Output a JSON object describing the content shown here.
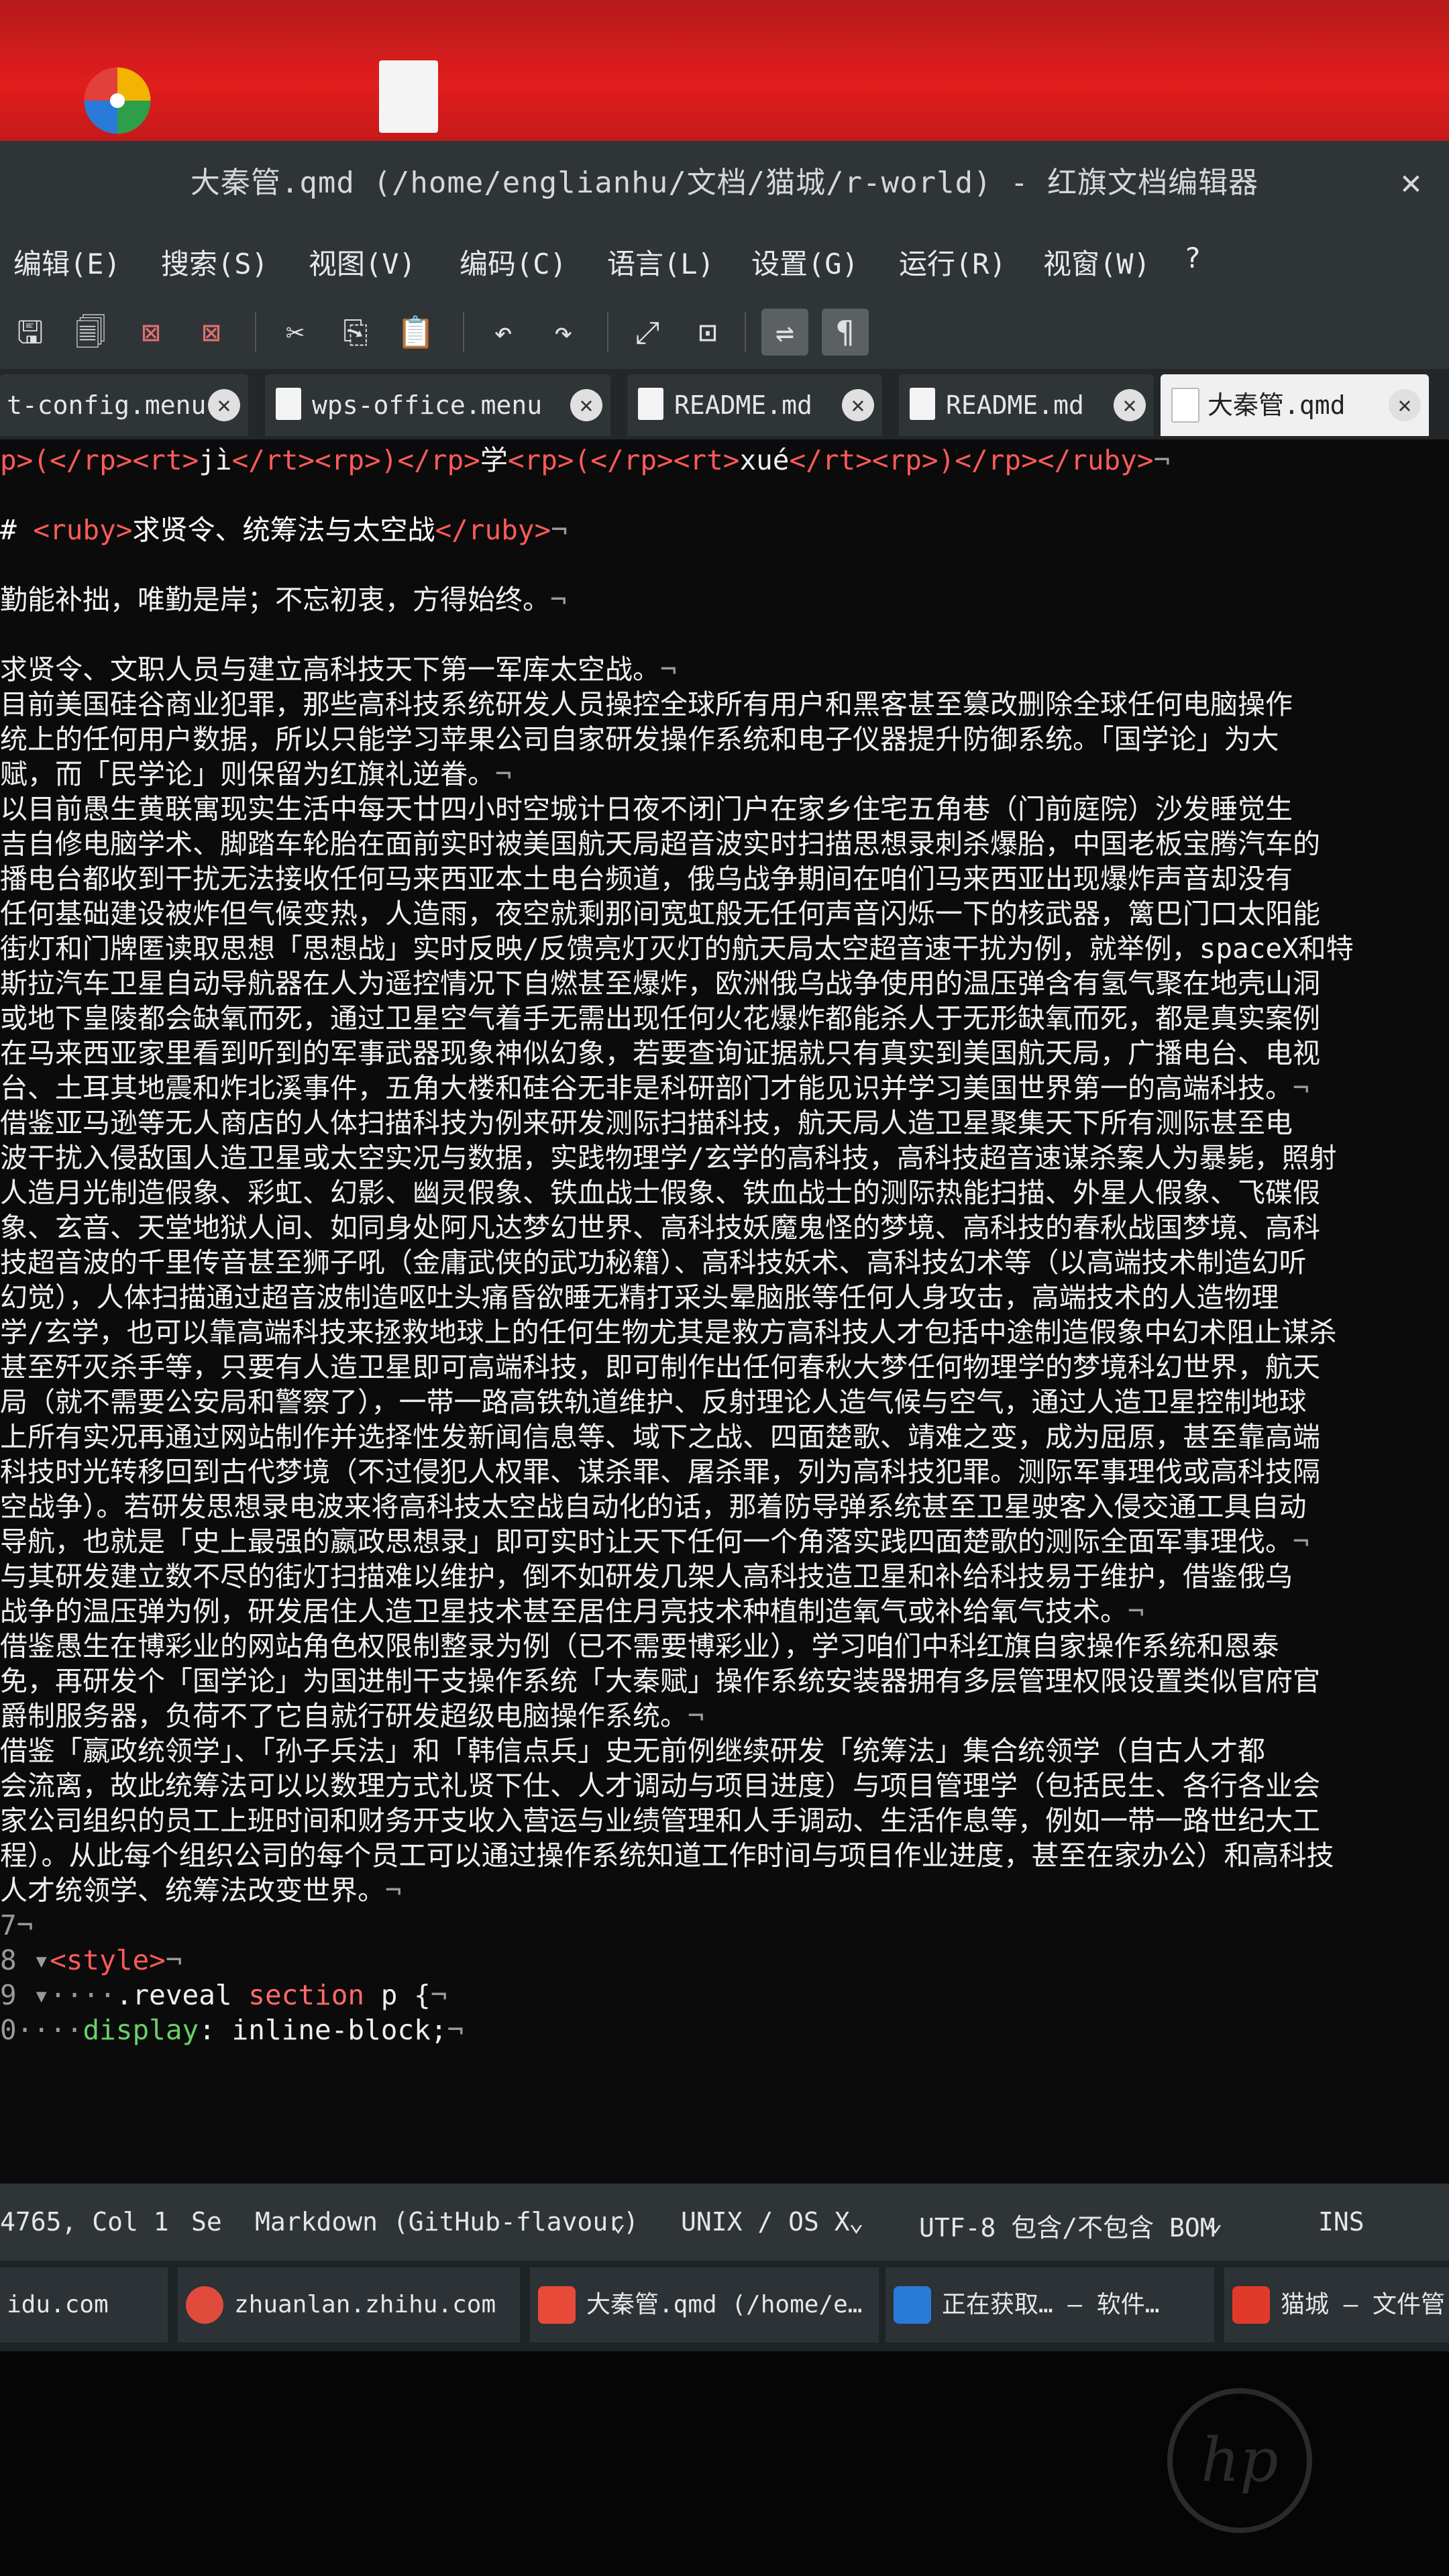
{
  "window": {
    "title": "大秦管.qmd (/home/englianhu/文档/猫城/r-world) - 红旗文档编辑器",
    "close_symbol": "✕"
  },
  "menu": [
    "编辑(E)",
    "搜索(S)",
    "视图(V)",
    "编码(C)",
    "语言(L)",
    "设置(G)",
    "运行(R)",
    "视窗(W)",
    "?"
  ],
  "toolbar": {
    "icons": [
      "save-icon",
      "save-all-icon",
      "close-file-icon",
      "close-all-icon",
      "cut-icon",
      "copy-icon",
      "paste-icon",
      "undo-icon",
      "redo-icon",
      "zoom-fit-icon",
      "zoom-reset-icon",
      "word-wrap-icon",
      "show-all-chars-icon"
    ],
    "glyphs": {
      "save": "🖫",
      "save_all": "🗐",
      "close_file": "⊠",
      "close_all": "⊠",
      "cut": "✂",
      "copy": "⎘",
      "paste": "📋",
      "undo": "↶",
      "redo": "↷",
      "zoom_fit": "⤢",
      "zoom_reset": "⊡",
      "word_wrap": "⇌",
      "pilcrow": "¶"
    }
  },
  "tabs": [
    {
      "label": "t-config.menu",
      "active": false
    },
    {
      "label": "wps-office.menu",
      "active": false
    },
    {
      "label": "README.md",
      "active": false
    },
    {
      "label": "README.md",
      "active": false
    },
    {
      "label": "大秦管.qmd",
      "active": true
    }
  ],
  "tab_close_symbol": "✕",
  "editor": {
    "lines": [
      {
        "gutter": "",
        "parts": [
          [
            "tag",
            "p>(</rp><rt>"
          ],
          [
            "txt",
            "jì"
          ],
          [
            "tag",
            "</rt><rp>)</rp>"
          ],
          [
            "txt",
            "学"
          ],
          [
            "tag",
            "<rp>(</rp><rt>"
          ],
          [
            "txt",
            "xué"
          ],
          [
            "tag",
            "</rt><rp>)</rp></ruby>"
          ],
          [
            "eol",
            "¬"
          ]
        ]
      },
      {
        "gutter": "",
        "parts": [
          [
            "txt",
            ""
          ]
        ]
      },
      {
        "gutter": "",
        "parts": [
          [
            "hdr",
            "# "
          ],
          [
            "tag",
            "<ruby>"
          ],
          [
            "hdr",
            "求贤令、统筹法与太空战"
          ],
          [
            "tag",
            "</ruby>"
          ],
          [
            "eol",
            "¬"
          ]
        ]
      },
      {
        "gutter": "",
        "parts": [
          [
            "txt",
            ""
          ]
        ]
      },
      {
        "gutter": "",
        "parts": [
          [
            "txt",
            "勤能补拙，唯勤是岸；不忘初衷，方得始终。"
          ],
          [
            "eol",
            "¬"
          ]
        ]
      },
      {
        "gutter": "",
        "parts": [
          [
            "txt",
            ""
          ]
        ]
      },
      {
        "gutter": "",
        "parts": [
          [
            "txt",
            "求贤令、文职人员与建立高科技天下第一军库太空战。"
          ],
          [
            "eol",
            "¬"
          ]
        ]
      },
      {
        "gutter": "",
        "parts": [
          [
            "txt",
            "目前美国硅谷商业犯罪，那些高科技系统研发人员操控全球所有用户和黑客甚至篡改删除全球任何电脑操作"
          ]
        ]
      },
      {
        "gutter": "",
        "parts": [
          [
            "txt",
            "统上的任何用户数据，所以只能学习苹果公司自家研发操作系统和电子仪器提升防御系统。「国学论」为大"
          ]
        ]
      },
      {
        "gutter": "",
        "parts": [
          [
            "txt",
            "赋，而「民学论」则保留为红旗礼逆眷。"
          ],
          [
            "eol",
            "¬"
          ]
        ]
      },
      {
        "gutter": "",
        "parts": [
          [
            "txt",
            "以目前愚生黄联寓现实生活中每天廿四小时空城计日夜不闭门户在家乡住宅五角巷（门前庭院）沙发睡觉生"
          ]
        ]
      },
      {
        "gutter": "",
        "parts": [
          [
            "txt",
            "吉自修电脑学术、脚踏车轮胎在面前实时被美国航天局超音波实时扫描思想录刺杀爆胎，中国老板宝腾汽车的"
          ]
        ]
      },
      {
        "gutter": "",
        "parts": [
          [
            "txt",
            "播电台都收到干扰无法接收任何马来西亚本土电台频道，俄乌战争期间在咱们马来西亚出现爆炸声音却没有"
          ]
        ]
      },
      {
        "gutter": "",
        "parts": [
          [
            "txt",
            "任何基础建设被炸但气候变热，人造雨，夜空就剩那间宽虹般无任何声音闪烁一下的核武器，篱巴门口太阳能"
          ]
        ]
      },
      {
        "gutter": "",
        "parts": [
          [
            "txt",
            "街灯和门牌匿读取思想「思想战」实时反映/反馈亮灯灭灯的航天局太空超音速干扰为例，就举例，spaceX和特"
          ]
        ]
      },
      {
        "gutter": "",
        "parts": [
          [
            "txt",
            "斯拉汽车卫星自动导航器在人为遥控情况下自燃甚至爆炸，欧洲俄乌战争使用的温压弹含有氢气聚在地壳山洞"
          ]
        ]
      },
      {
        "gutter": "",
        "parts": [
          [
            "txt",
            "或地下皇陵都会缺氧而死，通过卫星空气着手无需出现任何火花爆炸都能杀人于无形缺氧而死，都是真实案例"
          ]
        ]
      },
      {
        "gutter": "",
        "parts": [
          [
            "txt",
            "在马来西亚家里看到听到的军事武器现象神似幻象，若要查询证据就只有真实到美国航天局，广播电台、电视"
          ]
        ]
      },
      {
        "gutter": "",
        "parts": [
          [
            "txt",
            "台、土耳其地震和炸北溪事件，五角大楼和硅谷无非是科研部门才能见识并学习美国世界第一的高端科技。"
          ],
          [
            "eol",
            "¬"
          ]
        ]
      },
      {
        "gutter": "",
        "parts": [
          [
            "txt",
            "借鉴亚马逊等无人商店的人体扫描科技为例来研发测际扫描科技，航天局人造卫星聚集天下所有测际甚至电"
          ]
        ]
      },
      {
        "gutter": "",
        "parts": [
          [
            "txt",
            "波干扰入侵敌国人造卫星或太空实况与数据，实践物理学/玄学的高科技，高科技超音速谋杀案人为暴毙，照射"
          ]
        ]
      },
      {
        "gutter": "",
        "parts": [
          [
            "txt",
            "人造月光制造假象、彩虹、幻影、幽灵假象、铁血战士假象、铁血战士的测际热能扫描、外星人假象、飞碟假"
          ]
        ]
      },
      {
        "gutter": "",
        "parts": [
          [
            "txt",
            "象、玄音、天堂地狱人间、如同身处阿凡达梦幻世界、高科技妖魔鬼怪的梦境、高科技的春秋战国梦境、高科"
          ]
        ]
      },
      {
        "gutter": "",
        "parts": [
          [
            "txt",
            "技超音波的千里传音甚至狮子吼（金庸武侠的武功秘籍）、高科技妖术、高科技幻术等（以高端技术制造幻听"
          ]
        ]
      },
      {
        "gutter": "",
        "parts": [
          [
            "txt",
            "幻觉），人体扫描通过超音波制造呕吐头痛昏欲睡无精打采头晕脑胀等任何人身攻击，高端技术的人造物理"
          ]
        ]
      },
      {
        "gutter": "",
        "parts": [
          [
            "txt",
            "学/玄学，也可以靠高端科技来拯救地球上的任何生物尤其是救方高科技人才包括中途制造假象中幻术阻止谋杀"
          ]
        ]
      },
      {
        "gutter": "",
        "parts": [
          [
            "txt",
            "甚至歼灭杀手等，只要有人造卫星即可高端科技，即可制作出任何春秋大梦任何物理学的梦境科幻世界，航天"
          ]
        ]
      },
      {
        "gutter": "",
        "parts": [
          [
            "txt",
            "局（就不需要公安局和警察了），一带一路高铁轨道维护、反射理论人造气候与空气，通过人造卫星控制地球"
          ]
        ]
      },
      {
        "gutter": "",
        "parts": [
          [
            "txt",
            "上所有实况再通过网站制作并选择性发新闻信息等、域下之战、四面楚歌、靖难之变，成为屈原，甚至靠高端"
          ]
        ]
      },
      {
        "gutter": "",
        "parts": [
          [
            "txt",
            "科技时光转移回到古代梦境（不过侵犯人权罪、谋杀罪、屠杀罪，列为高科技犯罪。测际军事理伐或高科技隔"
          ]
        ]
      },
      {
        "gutter": "",
        "parts": [
          [
            "txt",
            "空战争）。若研发思想录电波来将高科技太空战自动化的话，那着防导弹系统甚至卫星驶客入侵交通工具自动"
          ]
        ]
      },
      {
        "gutter": "",
        "parts": [
          [
            "txt",
            "导航，也就是「史上最强的嬴政思想录」即可实时让天下任何一个角落实践四面楚歌的测际全面军事理伐。"
          ],
          [
            "eol",
            "¬"
          ]
        ]
      },
      {
        "gutter": "",
        "parts": [
          [
            "txt",
            "与其研发建立数不尽的街灯扫描难以维护，倒不如研发几架人高科技造卫星和补给科技易于维护，借鉴俄乌"
          ]
        ]
      },
      {
        "gutter": "",
        "parts": [
          [
            "txt",
            "战争的温压弹为例，研发居住人造卫星技术甚至居住月亮技术种植制造氧气或补给氧气技术。"
          ],
          [
            "eol",
            "¬"
          ]
        ]
      },
      {
        "gutter": "",
        "parts": [
          [
            "txt",
            "借鉴愚生在博彩业的网站角色权限制整录为例（已不需要博彩业），学习咱们中科红旗自家操作系统和恩泰"
          ]
        ]
      },
      {
        "gutter": "",
        "parts": [
          [
            "txt",
            "免，再研发个「国学论」为国进制干支操作系统「大秦赋」操作系统安装器拥有多层管理权限设置类似官府官"
          ]
        ]
      },
      {
        "gutter": "",
        "parts": [
          [
            "txt",
            "爵制服务器，负荷不了它自就行研发超级电脑操作系统。"
          ],
          [
            "eol",
            "¬"
          ]
        ]
      },
      {
        "gutter": "",
        "parts": [
          [
            "txt",
            "借鉴「嬴政统领学」、「孙子兵法」和「韩信点兵」史无前例继续研发「统筹法」集合统领学（自古人才都"
          ]
        ]
      },
      {
        "gutter": "",
        "parts": [
          [
            "txt",
            "会流离，故此统筹法可以以数理方式礼贤下仕、人才调动与项目进度）与项目管理学（包括民生、各行各业会"
          ]
        ]
      },
      {
        "gutter": "",
        "parts": [
          [
            "txt",
            "家公司组织的员工上班时间和财务开支收入营运与业绩管理和人手调动、生活作息等，例如一带一路世纪大工"
          ]
        ]
      },
      {
        "gutter": "",
        "parts": [
          [
            "txt",
            "程）。从此每个组织公司的每个员工可以通过操作系统知道工作时间与项目作业进度，甚至在家办公）和高科技"
          ]
        ]
      },
      {
        "gutter": "",
        "parts": [
          [
            "txt",
            "人才统领学、统筹法改变世界。"
          ],
          [
            "eol",
            "¬"
          ]
        ]
      },
      {
        "gutter": "7",
        "parts": [
          [
            "eol",
            "¬"
          ]
        ]
      },
      {
        "gutter": "8 ▾",
        "parts": [
          [
            "tag",
            "<style>"
          ],
          [
            "eol",
            "¬"
          ]
        ]
      },
      {
        "gutter": "9 ▾",
        "parts": [
          [
            "eol",
            "····"
          ],
          [
            "txt",
            ".reveal "
          ],
          [
            "kw",
            "section"
          ],
          [
            "txt",
            " p {"
          ],
          [
            "eol",
            "¬"
          ]
        ]
      },
      {
        "gutter": "0",
        "parts": [
          [
            "eol",
            "····"
          ],
          [
            "prop",
            "display"
          ],
          [
            "txt",
            ": inline-block;"
          ],
          [
            "eol",
            "¬"
          ]
        ]
      }
    ]
  },
  "status": {
    "position": "4765, Col 1",
    "sel": "Se",
    "language": "Markdown (GitHub-flavour)",
    "line_endings": "UNIX / OS X",
    "encoding": "UTF-8 包含/不包含 BOM",
    "mode": "INS",
    "dropdown_symbol": "⌄"
  },
  "taskbar": [
    {
      "label": "idu.com",
      "color": "#2c3236"
    },
    {
      "label": "zhuanlan.zhihu.com",
      "color": "#e14b3b"
    },
    {
      "label": "大秦管.qmd (/home/e…",
      "color": "#e84a3a"
    },
    {
      "label": "正在获取… — 软件…",
      "color": "#2a7bd8"
    },
    {
      "label": "猫城 — 文件管",
      "color": "#e23a2a"
    }
  ],
  "hp_logo": "hp"
}
